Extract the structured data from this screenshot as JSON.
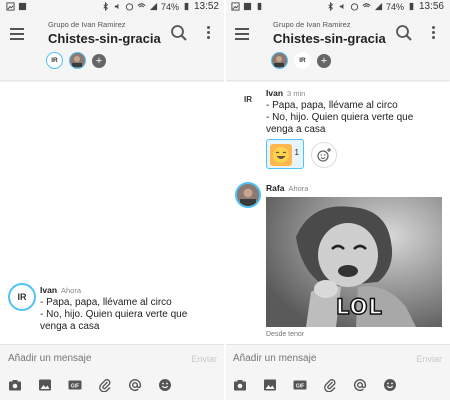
{
  "left": {
    "status": {
      "battery": "74%",
      "time": "13:52"
    },
    "header": {
      "subtitle": "Grupo de Ivan Ramirez",
      "title": "Chistes-sin-gracia"
    },
    "members": {
      "ir_initials": "IR"
    },
    "message": {
      "initials": "IR",
      "sender": "Ivan",
      "time": "Ahora",
      "lines": [
        "- Papa, papa, llévame al circo",
        "- No, hijo. Quien quiera verte que",
        "venga a casa"
      ]
    },
    "composer": {
      "placeholder": "Añadir un mensaje",
      "send_label": "Enviar"
    }
  },
  "right": {
    "status": {
      "battery": "74%",
      "time": "13:56"
    },
    "header": {
      "subtitle": "Grupo de Ivan Ramirez",
      "title": "Chistes-sin-gracia"
    },
    "members": {
      "ir_initials": "IR"
    },
    "message1": {
      "initials": "IR",
      "sender": "Ivan",
      "time": "3 min",
      "lines": [
        "- Papa, papa, llévame al circo",
        "- No, hijo. Quien quiera verte que",
        "venga a casa"
      ],
      "reaction_count": "1"
    },
    "message2": {
      "sender": "Rafa",
      "time": "Ahora",
      "gif_text": "LOL",
      "gif_source": "Desde tenor"
    },
    "composer": {
      "placeholder": "Añadir un mensaje",
      "send_label": "Enviar"
    }
  },
  "composer_tools": [
    "camera-icon",
    "image-icon",
    "gif-icon",
    "attach-icon",
    "mention-icon",
    "emoji-icon"
  ],
  "colors": {
    "accent": "#4fc3f7",
    "appbar": "#f5f5f5",
    "reaction_bg": "#e8f4fb"
  }
}
